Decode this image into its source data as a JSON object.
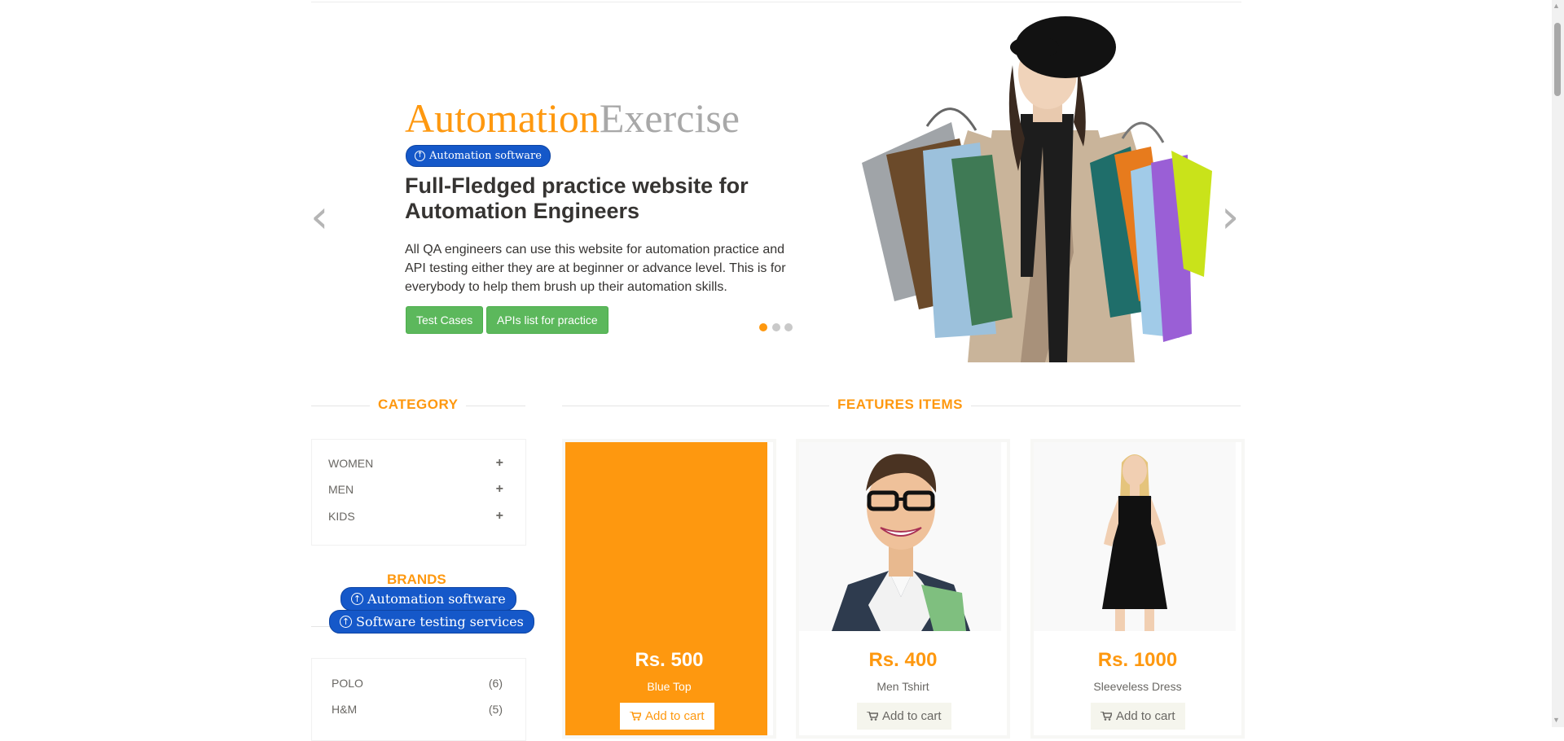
{
  "slider": {
    "brand_part1": "Automation",
    "brand_part2": "Exercise",
    "badge": "Automation software",
    "headline": "Full-Fledged practice website for Automation Engineers",
    "description": "All QA engineers can use this website for automation practice and API testing either they are at beginner or advance level. This is for everybody to help them brush up their automation skills.",
    "btn_test_cases": "Test Cases",
    "btn_apis": "APIs list for practice",
    "prev_icon": "‹",
    "next_icon": "›",
    "active_slide": 1,
    "slide_count": 3
  },
  "sidebar": {
    "category_title": "CATEGORY",
    "categories": [
      {
        "label": "WOMEN",
        "toggle": "+"
      },
      {
        "label": "MEN",
        "toggle": "+"
      },
      {
        "label": "KIDS",
        "toggle": "+"
      }
    ],
    "brands_title": "BRANDS",
    "ad_badges": [
      "Automation software",
      "Software testing services"
    ],
    "brands": [
      {
        "name": "POLO",
        "count": "(6)"
      },
      {
        "name": "H&M",
        "count": "(5)"
      }
    ]
  },
  "features": {
    "title": "FEATURES ITEMS",
    "products": [
      {
        "price": "Rs. 500",
        "name": "Blue Top",
        "cart_label": "Add to cart",
        "hovered": true
      },
      {
        "price": "Rs. 400",
        "name": "Men Tshirt",
        "cart_label": "Add to cart",
        "hovered": false
      },
      {
        "price": "Rs. 1000",
        "name": "Sleeveless Dress",
        "cart_label": "Add to cart",
        "hovered": false
      }
    ]
  },
  "colors": {
    "accent": "#fe980f",
    "green": "#5cb85c",
    "badge_blue": "#1558c9",
    "text": "#696763"
  }
}
